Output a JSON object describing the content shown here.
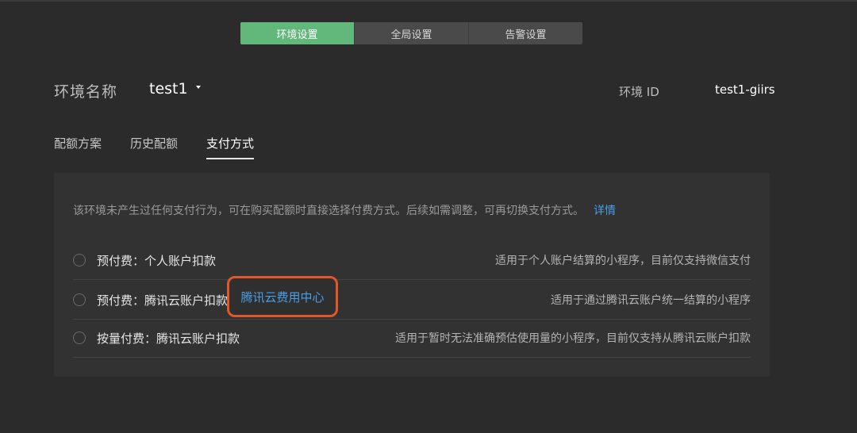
{
  "segmented_tabs": [
    {
      "label": "环境设置",
      "active": true
    },
    {
      "label": "全局设置",
      "active": false
    },
    {
      "label": "告警设置",
      "active": false
    }
  ],
  "env": {
    "name_label": "环境名称",
    "name_value": "test1",
    "id_label": "环境 ID",
    "id_value": "test1-giirs"
  },
  "subtabs": [
    {
      "label": "配额方案",
      "active": false
    },
    {
      "label": "历史配额",
      "active": false
    },
    {
      "label": "支付方式",
      "active": true
    }
  ],
  "panel": {
    "notice": "该环境未产生过任何支付行为，可在购买配额时直接选择付费方式。后续如需调整，可再切换支付方式。",
    "notice_link": "详情",
    "options": [
      {
        "label": "预付费：个人账户扣款",
        "desc": "适用于个人账户结算的小程序，目前仅支持微信支付"
      },
      {
        "label": "预付费：腾讯云账户扣款",
        "link": "腾讯云费用中心",
        "desc": "适用于通过腾讯云账户统一结算的小程序"
      },
      {
        "label": "按量付费：腾讯云账户扣款",
        "desc": "适用于暂时无法准确预估使用量的小程序，目前仅支持从腾讯云账户扣款"
      }
    ]
  },
  "colors": {
    "active_tab": "#62b87a",
    "link": "#4a9ee8",
    "highlight_border": "#e0572a"
  }
}
